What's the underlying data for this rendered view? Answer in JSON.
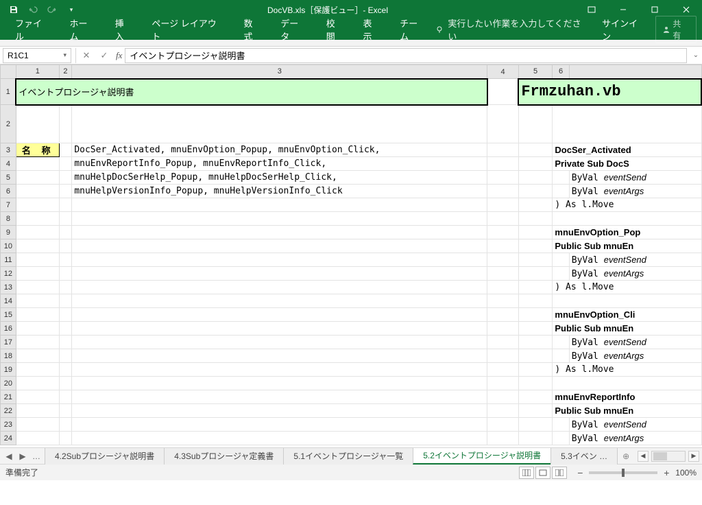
{
  "titlebar": {
    "title": "DocVB.xls［保護ビュー］- Excel"
  },
  "ribbon": {
    "tabs": [
      "ファイル",
      "ホーム",
      "挿入",
      "ページ レイアウト",
      "数式",
      "データ",
      "校閲",
      "表示",
      "チーム"
    ],
    "tellme": "実行したい作業を入力してください",
    "signin": "サインイン",
    "share": "共有"
  },
  "formula": {
    "namebox": "R1C1",
    "value": "イベントプロシージャ説明書"
  },
  "grid": {
    "col_headers": [
      "1",
      "2",
      "3",
      "4",
      "5",
      "6"
    ],
    "row_headers": [
      "1",
      "2",
      "3",
      "4",
      "5",
      "6",
      "7",
      "8",
      "9",
      "10",
      "11",
      "12",
      "13",
      "14",
      "15",
      "16",
      "17",
      "18",
      "19",
      "20",
      "21",
      "22",
      "23",
      "24"
    ],
    "title_left": "イベントプロシージャ説明書",
    "title_right": "Frmzuhan.vb",
    "label_meisho": "名 称",
    "content_lines": [
      "DocSer_Activated, mnuEnvOption_Popup, mnuEnvOption_Click,",
      "mnuEnvReportInfo_Popup, mnuEnvReportInfo_Click,",
      "mnuHelpDocSerHelp_Popup, mnuHelpDocSerHelp_Click,",
      "mnuHelpVersionInfo_Popup, mnuHelpVersionInfo_Click"
    ],
    "code_blocks": [
      {
        "head": "DocSer_Activated",
        "decl": "Private Sub DocS",
        "b1": "ByVal eventSend",
        "b2": "ByVal eventArgs",
        "end": ") As l.Move"
      },
      {
        "head": "mnuEnvOption_Pop",
        "decl": "Public Sub mnuEn",
        "b1": "ByVal eventSend",
        "b2": "ByVal eventArgs",
        "end": ") As l.Move"
      },
      {
        "head": "mnuEnvOption_Cli",
        "decl": "Public Sub mnuEn",
        "b1": "ByVal eventSend",
        "b2": "ByVal eventArgs",
        "end": ") As l.Move"
      },
      {
        "head": "mnuEnvReportInfo",
        "decl": "Public Sub mnuEn",
        "b1": "ByVal eventSend",
        "b2": "ByVal eventArgs",
        "end": ""
      }
    ]
  },
  "sheet_tabs": {
    "tabs": [
      "4.2Subプロシージャ説明書",
      "4.3Subプロシージャ定義書",
      "5.1イベントプロシージャ一覧",
      "5.2イベントプロシージャ説明書",
      "5.3イベン"
    ],
    "active_index": 3
  },
  "status": {
    "text": "準備完了",
    "zoom": "100%"
  }
}
